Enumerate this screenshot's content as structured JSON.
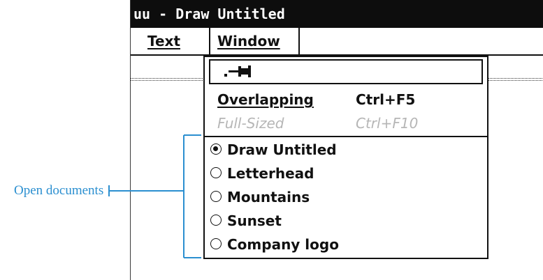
{
  "window": {
    "title": "uu - Draw Untitled"
  },
  "menubar": {
    "items": [
      {
        "label": "Text"
      },
      {
        "label": "Window"
      }
    ]
  },
  "window_menu": {
    "pin_icon": "pushpin-icon",
    "items": [
      {
        "label": "Overlapping",
        "shortcut": "Ctrl+F5",
        "enabled": true
      },
      {
        "label": "Full-Sized",
        "shortcut": "Ctrl+F10",
        "enabled": false
      }
    ],
    "documents": [
      {
        "label": "Draw Untitled",
        "selected": true
      },
      {
        "label": "Letterhead",
        "selected": false
      },
      {
        "label": "Mountains",
        "selected": false
      },
      {
        "label": "Sunset",
        "selected": false
      },
      {
        "label": "Company logo",
        "selected": false
      }
    ]
  },
  "annotation": {
    "label": "Open documents",
    "color": "#2b8fd0"
  }
}
